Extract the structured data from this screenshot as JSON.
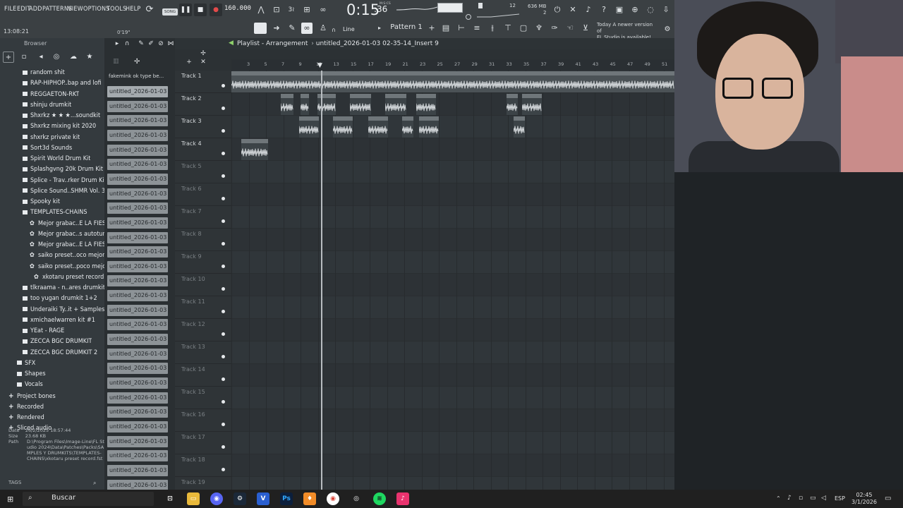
{
  "menu": {
    "items": [
      "FILE",
      "EDIT",
      "ADD",
      "PATTERNS",
      "VIEW",
      "OPTIONS",
      "TOOLS",
      "HELP"
    ],
    "song_mode": "SONG"
  },
  "transport": {
    "tempo": "160.000",
    "time": "0:15",
    "time_small": ":36",
    "time_unit": "M:S:CS",
    "song_position": "13:08:21",
    "zoom": "0'19\""
  },
  "status": {
    "cpu": "12",
    "memory": "636 MB",
    "polyphony": "2"
  },
  "news": {
    "line1": "Today  A newer version of",
    "line2": "FL Studio is available!"
  },
  "toolbar": {
    "snap": "Line",
    "pattern": "Pattern 1"
  },
  "browser": {
    "title": "Browser",
    "tree": [
      {
        "label": "random shit",
        "type": "folder"
      },
      {
        "label": "RAP-HIPHOP..bap and lofi",
        "type": "folder"
      },
      {
        "label": "REGGAETON-RKT",
        "type": "folder"
      },
      {
        "label": "shinju drumkit",
        "type": "folder"
      },
      {
        "label": "Shxrkz ★ ★ ★...soundkit",
        "type": "folder"
      },
      {
        "label": "Shxrkz mixing kit 2020",
        "type": "folder"
      },
      {
        "label": "shxrkz private kit",
        "type": "folder"
      },
      {
        "label": "Sort3d Sounds",
        "type": "folder"
      },
      {
        "label": "Spirit World Drum Kit",
        "type": "folder"
      },
      {
        "label": "Splashgvng 20k Drum Kit",
        "type": "folder"
      },
      {
        "label": "Splice - Trav..rker Drum Kit",
        "type": "folder"
      },
      {
        "label": "Splice Sound..SHMR Vol. 3",
        "type": "folder"
      },
      {
        "label": "Spooky kit",
        "type": "folder"
      },
      {
        "label": "TEMPLATES-CHAINS",
        "type": "folder"
      },
      {
        "label": "Mejor grabac..E LA FIESTA",
        "type": "preset"
      },
      {
        "label": "Mejor grabac..s autotune)",
        "type": "preset"
      },
      {
        "label": "Mejor grabac..E LA FIESTA",
        "type": "preset"
      },
      {
        "label": "saiko preset..oco mejor v2",
        "type": "preset"
      },
      {
        "label": "saiko preset..poco mejor",
        "type": "preset"
      },
      {
        "label": "xkotaru preset record",
        "type": "preset"
      },
      {
        "label": "tlkraama - n..ares drumkit",
        "type": "folder"
      },
      {
        "label": "too yugan drumkit 1+2",
        "type": "folder"
      },
      {
        "label": "Underaiki Ty..it + Samples",
        "type": "folder"
      },
      {
        "label": "xmichaelwarren kit #1",
        "type": "folder"
      },
      {
        "label": "YEat - RAGE",
        "type": "folder"
      },
      {
        "label": "ZECCA BGC DRUMKIT",
        "type": "folder"
      },
      {
        "label": "ZECCA BGC DRUMKIT 2",
        "type": "folder"
      },
      {
        "label": "SFX",
        "type": "folder"
      },
      {
        "label": "Shapes",
        "type": "folder"
      },
      {
        "label": "Vocals",
        "type": "folder"
      },
      {
        "label": "Project bones",
        "type": "root"
      },
      {
        "label": "Recorded",
        "type": "root"
      },
      {
        "label": "Rendered",
        "type": "root"
      },
      {
        "label": "Sliced audio",
        "type": "root"
      }
    ],
    "info": {
      "date_label": "Date",
      "date": "26/2/2025 18:57:44",
      "size_label": "Size",
      "size": "23.68 KB",
      "path_label": "Path",
      "path": "D:\\Program Files\\Image-Line\\FL Studio 2024\\Data\\Patches\\Packs\\SAMPLES Y DRUMKITS\\TEMPLATES-CHAINS\\xkotaru preset record.fst"
    },
    "tags_label": "TAGS"
  },
  "cliplist": {
    "title": "fakemink  ok type be...",
    "clips": [
      "untitled_2026-01-03 02-...",
      "untitled_2026-01-03 02-...",
      "untitled_2026-01-03 02-...",
      "untitled_2026-01-03 02-...",
      "untitled_2026-01-03 02-...",
      "untitled_2026-01-03 02-...",
      "untitled_2026-01-03 02-...",
      "untitled_2026-01-03 02-...",
      "untitled_2026-01-03 02-...",
      "untitled_2026-01-03 02-...",
      "untitled_2026-01-03 02-...",
      "untitled_2026-01-03 02-...",
      "untitled_2026-01-03 02-...",
      "untitled_2026-01-03 02-...",
      "untitled_2026-01-03 02-...",
      "untitled_2026-01-03 02-...",
      "untitled_2026-01-03 02-...",
      "untitled_2026-01-03 02-...",
      "untitled_2026-01-03 02-...",
      "untitled_2026-01-03 02-...",
      "untitled_2026-01-03 02-...",
      "untitled_2026-01-03 02-...",
      "untitled_2026-01-03 02-...",
      "untitled_2026-01-03 02-...",
      "untitled_2026-01-03 02-...",
      "untitled_2026-01-03 02-...",
      "untitled_2026-01-03 02-...",
      "untitled_2026-01-03 02-..."
    ]
  },
  "playlist": {
    "title": "Playlist - Arrangement",
    "clip_title": "untitled_2026-01-03 02-35-14_Insert 9",
    "ruler": [
      "3",
      "5",
      "7",
      "9",
      "11",
      "13",
      "15",
      "17",
      "19",
      "21",
      "23",
      "25",
      "27",
      "29",
      "31",
      "33",
      "35",
      "37",
      "39",
      "41",
      "43",
      "45",
      "47",
      "49",
      "51"
    ],
    "tracks": [
      "Track 1",
      "Track 2",
      "Track 3",
      "Track 4",
      "Track 5",
      "Track 6",
      "Track 7",
      "Track 8",
      "Track 9",
      "Track 10",
      "Track 11",
      "Track 12",
      "Track 13",
      "Track 14",
      "Track 15",
      "Track 16",
      "Track 17",
      "Track 18",
      "Track 19"
    ],
    "track1_clip_name": "fakemink  ok type beat - wisdom",
    "short_clip_name": "un..9",
    "track4_clip_name": "untit..rt 9"
  },
  "taskbar": {
    "search": "Buscar",
    "language": "ESP",
    "time": "02:45",
    "date": "3/1/2026"
  }
}
